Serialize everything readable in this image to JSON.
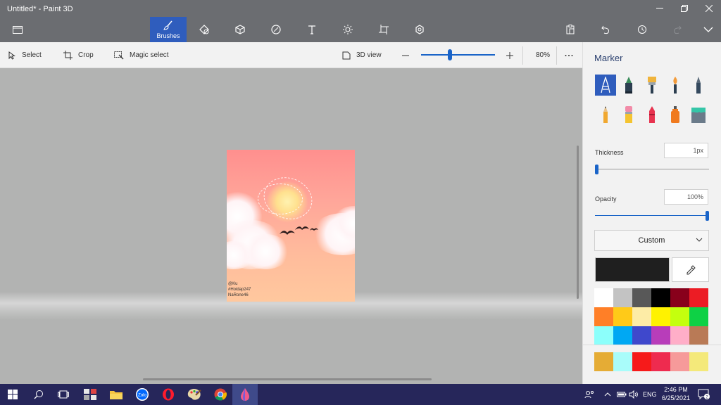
{
  "window": {
    "title": "Untitled* - Paint 3D"
  },
  "tabs": [
    {
      "name": "brushes",
      "label": "Brushes",
      "icon": "brush-icon",
      "active": true
    },
    {
      "name": "2d-shapes",
      "icon": "2d-shapes-icon"
    },
    {
      "name": "3d-shapes",
      "icon": "3d-shapes-icon"
    },
    {
      "name": "stickers",
      "icon": "stickers-icon"
    },
    {
      "name": "text",
      "icon": "text-icon"
    },
    {
      "name": "effects",
      "icon": "effects-icon"
    },
    {
      "name": "canvas",
      "icon": "canvas-icon"
    },
    {
      "name": "3d-library",
      "icon": "3d-library-icon"
    }
  ],
  "toolbar": {
    "select": "Select",
    "crop": "Crop",
    "magic_select": "Magic select",
    "view_3d": "3D view",
    "zoom": "80%",
    "zoom_level": 0.38
  },
  "artwork": {
    "watermark": [
      "@Ku",
      "#Hoidap247",
      "NaRone46"
    ]
  },
  "panel": {
    "title": "Marker",
    "brushes": [
      {
        "name": "marker",
        "icon": "marker-icon",
        "active": true
      },
      {
        "name": "calligraphy-pen",
        "icon": "calligraphy-pen-icon"
      },
      {
        "name": "oil-brush",
        "icon": "oil-brush-icon"
      },
      {
        "name": "watercolor",
        "icon": "watercolor-icon"
      },
      {
        "name": "pixel-pen",
        "icon": "pixel-pen-icon"
      },
      {
        "name": "pencil",
        "icon": "pencil-icon"
      },
      {
        "name": "eraser",
        "icon": "eraser-icon"
      },
      {
        "name": "crayon",
        "icon": "crayon-icon"
      },
      {
        "name": "spray-can",
        "icon": "spray-can-icon"
      },
      {
        "name": "fill",
        "icon": "fill-bucket-icon"
      }
    ],
    "thickness_label": "Thickness",
    "thickness_value": "1px",
    "thickness_level": 0.0,
    "opacity_label": "Opacity",
    "opacity_value": "100%",
    "opacity_level": 1.0,
    "color_mode": "Custom",
    "current_color": "#1f1f1f",
    "palette": [
      "#ffffff",
      "#c3c3c3",
      "#585858",
      "#000000",
      "#88001b",
      "#ec1c24",
      "#ff7f27",
      "#ffca18",
      "#fdeca6",
      "#fff200",
      "#c4ff0e",
      "#0ed145",
      "#8cfffb",
      "#00a8f3",
      "#3f48cc",
      "#b83dba",
      "#ffaec8",
      "#b97a56"
    ],
    "custom_palette": [
      "#e5ac35",
      "#a9fcfa",
      "#f61a1a",
      "#ee2b4f",
      "#f69a9a",
      "#f4e97a"
    ]
  },
  "taskbar": {
    "apps": [
      "windows-start",
      "search",
      "task-view",
      "apps-store",
      "file-explorer",
      "zalo",
      "opera",
      "paint",
      "chrome",
      "paint-3d"
    ],
    "zalo_label": "Zalo",
    "lang": "ENG",
    "time": "2:46 PM",
    "date": "6/25/2021",
    "notifications": "2"
  }
}
